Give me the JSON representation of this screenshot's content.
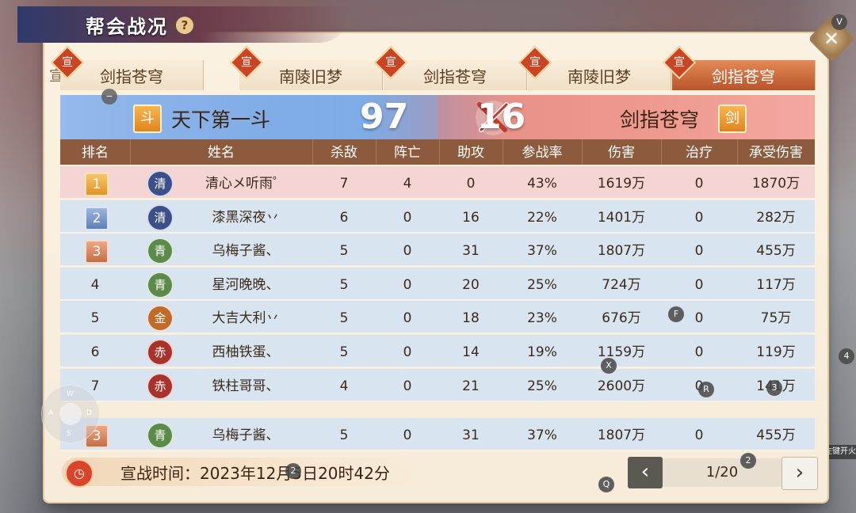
{
  "header": {
    "title": "帮会战况",
    "help_label": "?",
    "close_label": "✕",
    "v_key": "V"
  },
  "tabs": [
    {
      "label": "剑指苍穹",
      "badge": "宣"
    },
    {
      "label": "南陵旧梦",
      "badge": "宣"
    },
    {
      "label": "剑指苍穹",
      "badge": "宣"
    },
    {
      "label": "南陵旧梦",
      "badge": "宣"
    },
    {
      "label": "剑指苍穹",
      "badge": "宣",
      "active": true
    }
  ],
  "tab_edge_char": "宣",
  "scoreboard": {
    "left": {
      "icon": "斗",
      "name": "天下第一斗",
      "score": "97"
    },
    "right": {
      "icon": "剑",
      "name": "剑指苍穹",
      "score": "16"
    }
  },
  "table": {
    "headers": [
      "排名",
      "姓名",
      "杀敌",
      "阵亡",
      "助攻",
      "参战率",
      "伤害",
      "治疗",
      "承受伤害"
    ],
    "rows": [
      {
        "rank": "1",
        "class_icon": "清",
        "name": "清心メ听雨゜",
        "kills": "7",
        "deaths": "4",
        "assists": "0",
        "rate": "43%",
        "damage": "1619万",
        "heal": "0",
        "taken": "1870万"
      },
      {
        "rank": "2",
        "class_icon": "清",
        "name": "漆黑深夜丷",
        "kills": "6",
        "deaths": "0",
        "assists": "16",
        "rate": "22%",
        "damage": "1401万",
        "heal": "0",
        "taken": "282万"
      },
      {
        "rank": "3",
        "class_icon": "青",
        "name": "乌梅子酱、",
        "kills": "5",
        "deaths": "0",
        "assists": "31",
        "rate": "37%",
        "damage": "1807万",
        "heal": "0",
        "taken": "455万"
      },
      {
        "rank": "4",
        "class_icon": "青",
        "name": "星河晚晚、",
        "kills": "5",
        "deaths": "0",
        "assists": "20",
        "rate": "25%",
        "damage": "724万",
        "heal": "0",
        "taken": "117万"
      },
      {
        "rank": "5",
        "class_icon": "金",
        "name": "大吉大利丷",
        "kills": "5",
        "deaths": "0",
        "assists": "18",
        "rate": "23%",
        "damage": "676万",
        "heal": "0",
        "taken": "75万"
      },
      {
        "rank": "6",
        "class_icon": "赤",
        "name": "西柚铁蛋、",
        "kills": "5",
        "deaths": "0",
        "assists": "14",
        "rate": "19%",
        "damage": "1159万",
        "heal": "0",
        "taken": "119万"
      },
      {
        "rank": "7",
        "class_icon": "赤",
        "name": "铁柱哥哥、",
        "kills": "4",
        "deaths": "0",
        "assists": "21",
        "rate": "25%",
        "damage": "2600万",
        "heal": "0",
        "taken": "141万"
      }
    ],
    "self_row": {
      "rank": "3",
      "class_icon": "青",
      "name": "乌梅子酱、",
      "kills": "5",
      "deaths": "0",
      "assists": "31",
      "rate": "37%",
      "damage": "1807万",
      "heal": "0",
      "taken": "455万"
    }
  },
  "footer": {
    "time_label": "宣战时间：2023年12月5日20时42分",
    "page": "1/20",
    "prev_label": "‹",
    "next_label": "›"
  },
  "key_hints": [
    "F",
    "X",
    "R",
    "3",
    "4",
    "2",
    "Q",
    "2"
  ],
  "joystick": {
    "up": "W",
    "left": "A",
    "down": "S",
    "right": "D"
  },
  "side_tip": "鼠标左键开火",
  "colors": {
    "blue_team": "#4a7fd0",
    "red_team": "#e56b63",
    "header_row": "#8c5a3c",
    "row_bg": "#d9e4f1",
    "self_row_bg": "#f5d4d4",
    "active_tab": "#c46a3c"
  }
}
